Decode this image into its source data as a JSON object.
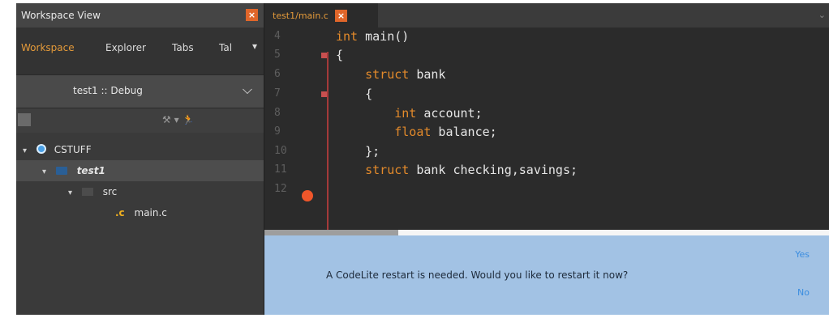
{
  "workspace": {
    "title": "Workspace View",
    "close_icon": "×",
    "tabs": [
      "Workspace",
      "Explorer",
      "Tabs",
      "Tal"
    ],
    "tabs_more": "▾",
    "configuration": "test1 :: Debug",
    "config_chevron": "⌵",
    "toolbar_icons": "⚒ ▾",
    "run_icon": "🏃",
    "tree": {
      "root": "CSTUFF",
      "project": "test1",
      "folder": "src",
      "file": "main.c",
      "file_icon_letter": ".c",
      "chevron": "▾"
    }
  },
  "editor": {
    "tab_label": "test1/main.c",
    "tab_close": "×",
    "tabs_chevron": "⌄",
    "line_numbers": [
      "4",
      "5",
      "6",
      "7",
      "8",
      "9",
      "10",
      "11",
      "12"
    ],
    "code_lines": [
      {
        "kw": "int",
        "rest": " main()"
      },
      {
        "kw": "",
        "rest": "{"
      },
      {
        "kw": "    struct",
        "rest": " bank"
      },
      {
        "kw": "",
        "rest": "    {"
      },
      {
        "kw": "        int",
        "rest": " account;"
      },
      {
        "kw": "        float",
        "rest": " balance;"
      },
      {
        "kw": "",
        "rest": "    };"
      },
      {
        "kw": "    struct",
        "rest": " bank checking,savings;"
      },
      {
        "kw": "",
        "rest": ""
      }
    ]
  },
  "infobar": {
    "message": "A CodeLite restart is needed. Would you like to restart it now?",
    "yes_label": "Yes",
    "no_label": "No",
    "background": "#a2c2e4"
  },
  "colors": {
    "accent": "#e49a3a",
    "close_button": "#e0662a",
    "keyword": "#e38a2b",
    "breakpoint": "#f0562a"
  }
}
